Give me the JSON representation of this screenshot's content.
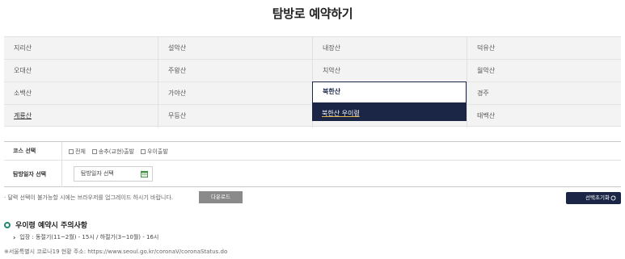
{
  "page": {
    "title": "탐방로 예약하기"
  },
  "mountains": {
    "rows": [
      [
        "지리산",
        "설악산",
        "내장산",
        "덕유산"
      ],
      [
        "오대산",
        "주왕산",
        "치악산",
        "월악산"
      ],
      [
        "소백산",
        "가야산",
        "",
        "경주"
      ],
      [
        "계룡산",
        "무등산",
        "",
        "태백산"
      ]
    ],
    "selected": "북한산",
    "dropdown_option": "북한산 우이령"
  },
  "form": {
    "course_label": "코스 선택",
    "course_options": [
      "전체",
      "송추(교현)출발",
      "우이출발"
    ],
    "date_label": "탐방일자 선택",
    "date_placeholder": "탐방일자 선택"
  },
  "notice": {
    "text": "· 달력 선택이 불가능할 시에는 브라우저를 업그레이드 하시기 바랍니다.",
    "download_label": "다운로드",
    "reset_label": "선택초기화"
  },
  "caution": {
    "title": "우이령 예약시 주의사항",
    "item": "입장 : 동절기(11~2월) - 15시 / 하절기(3~10월) - 16시"
  },
  "footer": {
    "note": "※서울특별시 코로나19 현황 주소: https://www.seoul.go.kr/coronaV/coronaStatus.do"
  },
  "colors": {
    "navy": "#1b2647",
    "accent_green": "#1f8a70",
    "download_gray": "#8a8a8a"
  }
}
